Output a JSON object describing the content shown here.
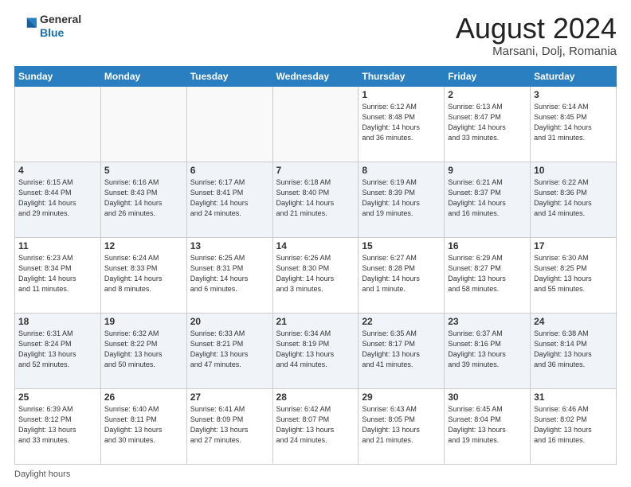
{
  "header": {
    "logo_line1": "General",
    "logo_line2": "Blue",
    "main_title": "August 2024",
    "subtitle": "Marsani, Dolj, Romania"
  },
  "footer": {
    "label": "Daylight hours"
  },
  "calendar": {
    "days_of_week": [
      "Sunday",
      "Monday",
      "Tuesday",
      "Wednesday",
      "Thursday",
      "Friday",
      "Saturday"
    ],
    "weeks": [
      [
        {
          "day": "",
          "info": ""
        },
        {
          "day": "",
          "info": ""
        },
        {
          "day": "",
          "info": ""
        },
        {
          "day": "",
          "info": ""
        },
        {
          "day": "1",
          "info": "Sunrise: 6:12 AM\nSunset: 8:48 PM\nDaylight: 14 hours\nand 36 minutes."
        },
        {
          "day": "2",
          "info": "Sunrise: 6:13 AM\nSunset: 8:47 PM\nDaylight: 14 hours\nand 33 minutes."
        },
        {
          "day": "3",
          "info": "Sunrise: 6:14 AM\nSunset: 8:45 PM\nDaylight: 14 hours\nand 31 minutes."
        }
      ],
      [
        {
          "day": "4",
          "info": "Sunrise: 6:15 AM\nSunset: 8:44 PM\nDaylight: 14 hours\nand 29 minutes."
        },
        {
          "day": "5",
          "info": "Sunrise: 6:16 AM\nSunset: 8:43 PM\nDaylight: 14 hours\nand 26 minutes."
        },
        {
          "day": "6",
          "info": "Sunrise: 6:17 AM\nSunset: 8:41 PM\nDaylight: 14 hours\nand 24 minutes."
        },
        {
          "day": "7",
          "info": "Sunrise: 6:18 AM\nSunset: 8:40 PM\nDaylight: 14 hours\nand 21 minutes."
        },
        {
          "day": "8",
          "info": "Sunrise: 6:19 AM\nSunset: 8:39 PM\nDaylight: 14 hours\nand 19 minutes."
        },
        {
          "day": "9",
          "info": "Sunrise: 6:21 AM\nSunset: 8:37 PM\nDaylight: 14 hours\nand 16 minutes."
        },
        {
          "day": "10",
          "info": "Sunrise: 6:22 AM\nSunset: 8:36 PM\nDaylight: 14 hours\nand 14 minutes."
        }
      ],
      [
        {
          "day": "11",
          "info": "Sunrise: 6:23 AM\nSunset: 8:34 PM\nDaylight: 14 hours\nand 11 minutes."
        },
        {
          "day": "12",
          "info": "Sunrise: 6:24 AM\nSunset: 8:33 PM\nDaylight: 14 hours\nand 8 minutes."
        },
        {
          "day": "13",
          "info": "Sunrise: 6:25 AM\nSunset: 8:31 PM\nDaylight: 14 hours\nand 6 minutes."
        },
        {
          "day": "14",
          "info": "Sunrise: 6:26 AM\nSunset: 8:30 PM\nDaylight: 14 hours\nand 3 minutes."
        },
        {
          "day": "15",
          "info": "Sunrise: 6:27 AM\nSunset: 8:28 PM\nDaylight: 14 hours\nand 1 minute."
        },
        {
          "day": "16",
          "info": "Sunrise: 6:29 AM\nSunset: 8:27 PM\nDaylight: 13 hours\nand 58 minutes."
        },
        {
          "day": "17",
          "info": "Sunrise: 6:30 AM\nSunset: 8:25 PM\nDaylight: 13 hours\nand 55 minutes."
        }
      ],
      [
        {
          "day": "18",
          "info": "Sunrise: 6:31 AM\nSunset: 8:24 PM\nDaylight: 13 hours\nand 52 minutes."
        },
        {
          "day": "19",
          "info": "Sunrise: 6:32 AM\nSunset: 8:22 PM\nDaylight: 13 hours\nand 50 minutes."
        },
        {
          "day": "20",
          "info": "Sunrise: 6:33 AM\nSunset: 8:21 PM\nDaylight: 13 hours\nand 47 minutes."
        },
        {
          "day": "21",
          "info": "Sunrise: 6:34 AM\nSunset: 8:19 PM\nDaylight: 13 hours\nand 44 minutes."
        },
        {
          "day": "22",
          "info": "Sunrise: 6:35 AM\nSunset: 8:17 PM\nDaylight: 13 hours\nand 41 minutes."
        },
        {
          "day": "23",
          "info": "Sunrise: 6:37 AM\nSunset: 8:16 PM\nDaylight: 13 hours\nand 39 minutes."
        },
        {
          "day": "24",
          "info": "Sunrise: 6:38 AM\nSunset: 8:14 PM\nDaylight: 13 hours\nand 36 minutes."
        }
      ],
      [
        {
          "day": "25",
          "info": "Sunrise: 6:39 AM\nSunset: 8:12 PM\nDaylight: 13 hours\nand 33 minutes."
        },
        {
          "day": "26",
          "info": "Sunrise: 6:40 AM\nSunset: 8:11 PM\nDaylight: 13 hours\nand 30 minutes."
        },
        {
          "day": "27",
          "info": "Sunrise: 6:41 AM\nSunset: 8:09 PM\nDaylight: 13 hours\nand 27 minutes."
        },
        {
          "day": "28",
          "info": "Sunrise: 6:42 AM\nSunset: 8:07 PM\nDaylight: 13 hours\nand 24 minutes."
        },
        {
          "day": "29",
          "info": "Sunrise: 6:43 AM\nSunset: 8:05 PM\nDaylight: 13 hours\nand 21 minutes."
        },
        {
          "day": "30",
          "info": "Sunrise: 6:45 AM\nSunset: 8:04 PM\nDaylight: 13 hours\nand 19 minutes."
        },
        {
          "day": "31",
          "info": "Sunrise: 6:46 AM\nSunset: 8:02 PM\nDaylight: 13 hours\nand 16 minutes."
        }
      ]
    ]
  }
}
